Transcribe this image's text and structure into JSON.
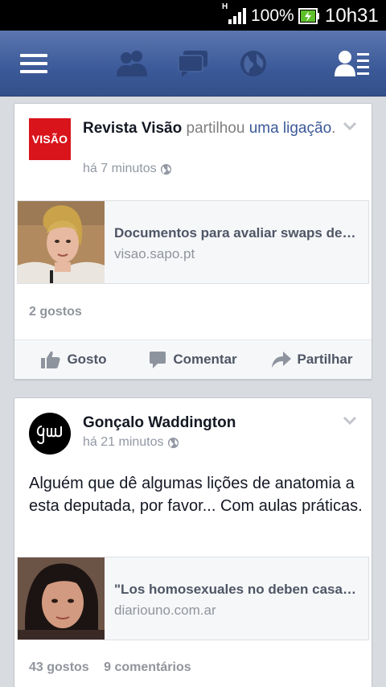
{
  "status_bar": {
    "network": "H",
    "battery": "100%",
    "time": "10h31"
  },
  "nav": {
    "icons": [
      "menu-icon",
      "friends-icon",
      "messages-icon",
      "globe-icon",
      "contacts-icon"
    ]
  },
  "posts": [
    {
      "author": "Revista Visão",
      "action_text": "partilhou",
      "link_text": "uma ligação",
      "punct": ".",
      "avatar_text": "VISÃO",
      "time": "há 7 minutos",
      "attachment": {
        "title": "Documentos para avaliar swaps destruídos",
        "domain": "visao.sapo.pt"
      },
      "likes": "2 gostos",
      "comments": ""
    },
    {
      "author": "Gonçalo Waddington",
      "time": "há 21 minutos",
      "text": "Alguém que dê algumas lições de anatomia a esta deputada, por favor... Com aulas práticas.",
      "attachment": {
        "title": "\"Los homosexuales no deben casarse\"",
        "domain": "diariouno.com.ar"
      },
      "likes": "43 gostos",
      "comments": "9 comentários"
    }
  ],
  "actions": {
    "like": "Gosto",
    "comment": "Comentar",
    "share": "Partilhar"
  },
  "colors": {
    "brand": "#3b5998",
    "visao_red": "#d9141b"
  }
}
